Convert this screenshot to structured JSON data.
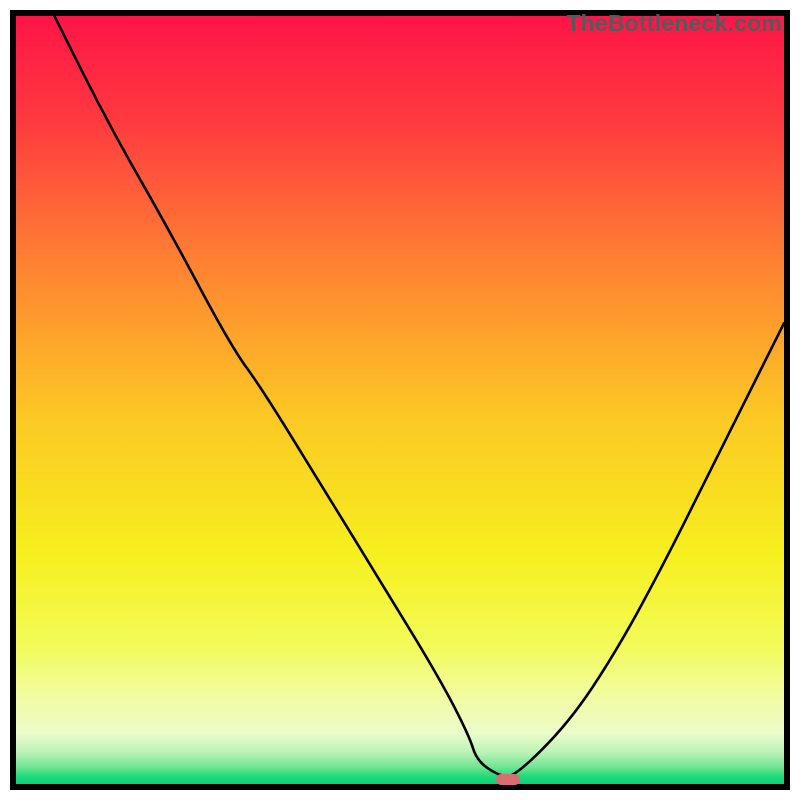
{
  "watermark": "TheBottleneck.com",
  "chart_data": {
    "type": "line",
    "title": "",
    "xlabel": "",
    "ylabel": "",
    "xlim": [
      0,
      100
    ],
    "ylim": [
      0,
      100
    ],
    "grid": false,
    "legend": false,
    "series": [
      {
        "name": "bottleneck-curve",
        "x": [
          5.0,
          12,
          20,
          28,
          32,
          40,
          48,
          55,
          59,
          60,
          63,
          65,
          72,
          78,
          84,
          90,
          95,
          100
        ],
        "values": [
          100,
          86,
          72,
          57,
          51.5,
          38.5,
          25.5,
          14,
          6.3,
          3.0,
          1.0,
          1.0,
          8.0,
          17,
          28,
          40,
          50,
          60
        ]
      }
    ],
    "marker": {
      "x": 64,
      "y": 0.7,
      "color": "#da6d72"
    },
    "background_gradient": {
      "type": "vertical",
      "stops": [
        {
          "pos": 0.0,
          "color": "#ff1447"
        },
        {
          "pos": 0.14,
          "color": "#ff3b3f"
        },
        {
          "pos": 0.32,
          "color": "#fe8132"
        },
        {
          "pos": 0.52,
          "color": "#fcc824"
        },
        {
          "pos": 0.7,
          "color": "#f6ef1e"
        },
        {
          "pos": 0.82,
          "color": "#f3fb58"
        },
        {
          "pos": 0.89,
          "color": "#f1fca5"
        },
        {
          "pos": 0.935,
          "color": "#eafccb"
        },
        {
          "pos": 0.96,
          "color": "#b8f2b4"
        },
        {
          "pos": 0.978,
          "color": "#6fe591"
        },
        {
          "pos": 0.99,
          "color": "#22da7b"
        },
        {
          "pos": 1.0,
          "color": "#05d477"
        }
      ]
    }
  }
}
